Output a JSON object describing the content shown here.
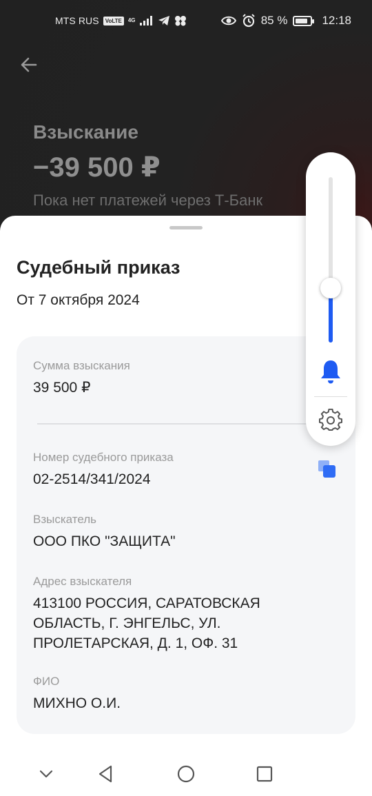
{
  "status_bar": {
    "carrier": "MTS RUS",
    "volte": "VoLTE",
    "network": "4G",
    "battery_text": "85 %",
    "battery_level": 0.85,
    "time": "12:18",
    "icons": [
      "signal-icon",
      "telegram-icon",
      "app-icon",
      "eye-icon",
      "alarm-icon",
      "battery-icon"
    ]
  },
  "background": {
    "title": "Взыскание",
    "amount": "−39 500 ₽",
    "subtitle": "Пока нет платежей через Т-Банк"
  },
  "sheet": {
    "title": "Судебный приказ",
    "subtitle": "От 7 октября 2024",
    "fields": [
      {
        "label": "Сумма взыскания",
        "value": "39 500 ₽"
      },
      {
        "label": "Номер судебного приказа",
        "value": "02-2514/341/2024"
      },
      {
        "label": "Взыскатель",
        "value": "ООО ПКО \"ЗАЩИТА\""
      },
      {
        "label": "Адрес взыскателя",
        "value": "413100 РОССИЯ, САРАТОВСКАЯ ОБЛАСТЬ, Г. ЭНГЕЛЬС, УЛ. ПРОЛЕТАРСКАЯ, Д. 1, ОФ. 31"
      },
      {
        "label": "ФИО",
        "value": "МИХНО О.И."
      }
    ]
  },
  "volume_popup": {
    "level": 0.33,
    "accent": "#1e5bf2",
    "icons": [
      "bell-icon",
      "gear-icon"
    ]
  },
  "nav_bar": {
    "icons": [
      "chevron-down-icon",
      "back-triangle-icon",
      "home-circle-icon",
      "recents-square-icon"
    ]
  }
}
